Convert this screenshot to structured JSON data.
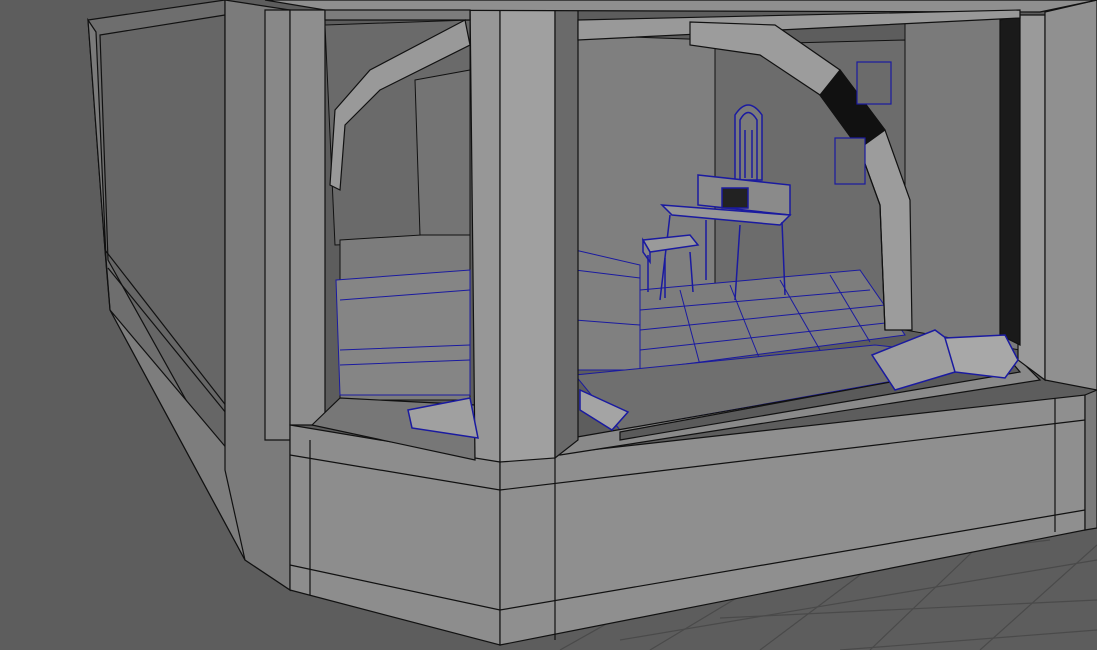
{
  "viewport": {
    "background_color": "#5d5d5d",
    "grid_line_color": "#4a4a4a",
    "geometry_color": "#8c8c8c",
    "edge_color": "#111111",
    "selected_wire_color": "#1a1aa0",
    "objects": [
      {
        "name": "ground-grid"
      },
      {
        "name": "building-shell"
      },
      {
        "name": "left-side-wall"
      },
      {
        "name": "front-wall-base"
      },
      {
        "name": "center-pillar"
      },
      {
        "name": "right-pillar"
      },
      {
        "name": "top-beam"
      },
      {
        "name": "left-arch"
      },
      {
        "name": "right-arch"
      },
      {
        "name": "window-sill"
      },
      {
        "name": "bed-platform"
      },
      {
        "name": "tiled-floor"
      },
      {
        "name": "vanity-desk"
      },
      {
        "name": "vanity-mirror"
      },
      {
        "name": "stool"
      },
      {
        "name": "pillows"
      },
      {
        "name": "picture-frames"
      }
    ]
  }
}
